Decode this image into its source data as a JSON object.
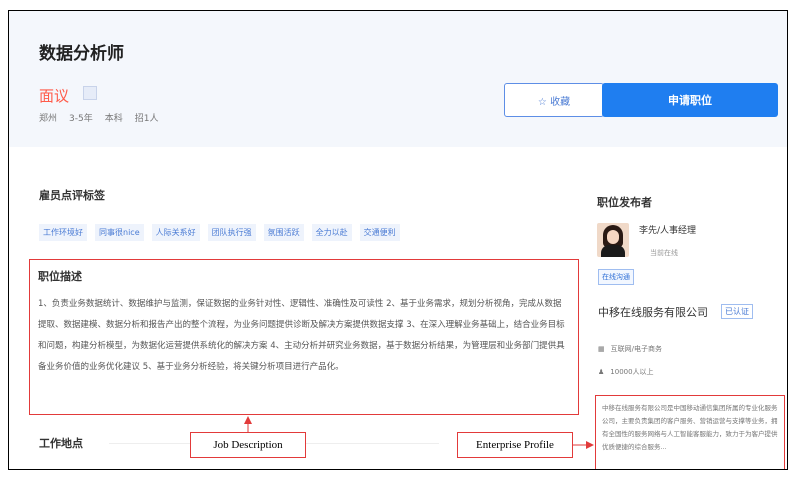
{
  "job": {
    "title": "数据分析师",
    "salary": "面议",
    "meta": [
      "郑州",
      "3-5年",
      "本科",
      "招1人"
    ]
  },
  "actions": {
    "favorite_label": "☆ 收藏",
    "apply_label": "申请职位"
  },
  "employee_tags": {
    "title": "雇员点评标签",
    "tags": [
      "工作环境好",
      "同事很nice",
      "人际关系好",
      "团队执行强",
      "氛围活跃",
      "全力以赴",
      "交通便利"
    ]
  },
  "job_description": {
    "title": "职位描述",
    "text": "1、负责业务数据统计、数据维护与监测，保证数据的业务针对性、逻辑性、准确性及可读性 2、基于业务需求，规划分析视角，完成从数据提取、数据建模、数据分析和报告产出的整个流程，为业务问题提供诊断及解决方案提供数据支撑 3、在深入理解业务基础上，结合业务目标和问题，构建分析模型，为数据化运营提供系统化的解决方案 4、主动分析并研究业务数据，基于数据分析结果，为管理层和业务部门提供具备业务价值的业务优化建议 5、基于业务分析经验，将关键分析项目进行产品化。"
  },
  "work_location": {
    "title": "工作地点"
  },
  "sidebar": {
    "title": "职位发布者",
    "recruiter_name": "李先/人事经理",
    "recruiter_status": "当前在线",
    "online_badge": "在线沟通",
    "company_name": "中移在线服务有限公司",
    "verified_label": "已认证",
    "industry": "互联网/电子商务",
    "size": "10000人以上",
    "company_profile": "中移在线服务有限公司是中国移动通信集团所属的专业化服务公司，主要负责集团的客户服务、营销运营与支撑等业务，拥有全国性的服务网络与人工智能客服能力，致力于为客户提供优质便捷的综合服务..."
  },
  "annotations": {
    "job_description_label": "Job Description",
    "enterprise_profile_label": "Enterprise Profile"
  },
  "colors": {
    "accent": "#1f7ef0",
    "salary": "#ff5b4a",
    "annotation_border": "#e23a3a"
  }
}
